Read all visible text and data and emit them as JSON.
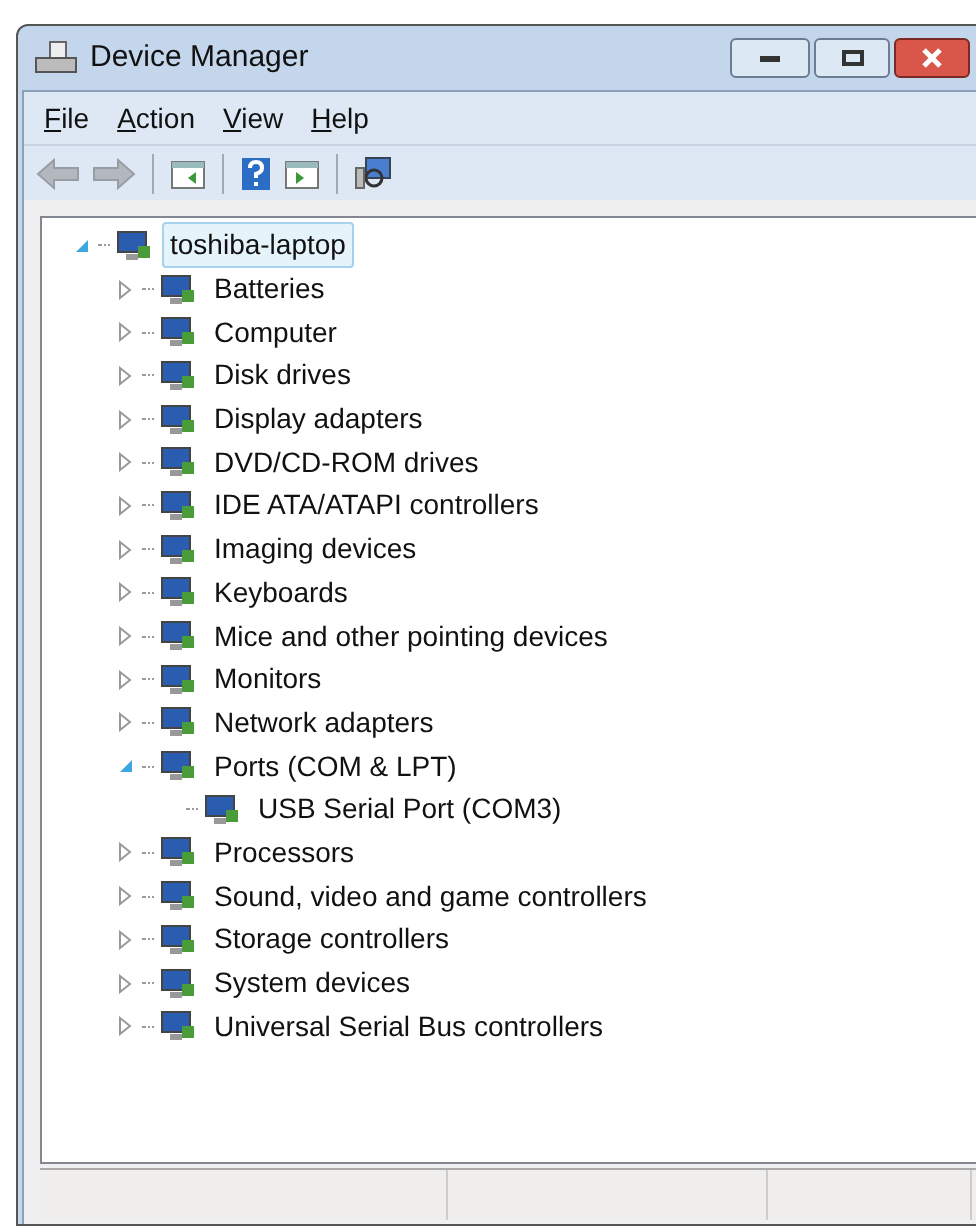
{
  "window": {
    "title": "Device Manager"
  },
  "menu": [
    {
      "label": "File"
    },
    {
      "label": "Action"
    },
    {
      "label": "View"
    },
    {
      "label": "Help"
    }
  ],
  "toolbar": [
    {
      "kind": "back",
      "disabled": true
    },
    {
      "kind": "forward",
      "disabled": true
    },
    {
      "kind": "separator"
    },
    {
      "kind": "console-tree"
    },
    {
      "kind": "separator"
    },
    {
      "kind": "help"
    },
    {
      "kind": "action-pane"
    },
    {
      "kind": "separator"
    },
    {
      "kind": "scan"
    }
  ],
  "tree": {
    "label": "toshiba-laptop",
    "selected": true,
    "expanded": true,
    "children": [
      {
        "label": "Batteries",
        "expanded": false
      },
      {
        "label": "Computer",
        "expanded": false
      },
      {
        "label": "Disk drives",
        "expanded": false
      },
      {
        "label": "Display adapters",
        "expanded": false
      },
      {
        "label": "DVD/CD-ROM drives",
        "expanded": false
      },
      {
        "label": "IDE ATA/ATAPI controllers",
        "expanded": false
      },
      {
        "label": "Imaging devices",
        "expanded": false
      },
      {
        "label": "Keyboards",
        "expanded": false
      },
      {
        "label": "Mice and other pointing devices",
        "expanded": false
      },
      {
        "label": "Monitors",
        "expanded": false
      },
      {
        "label": "Network adapters",
        "expanded": false
      },
      {
        "label": "Ports (COM & LPT)",
        "expanded": true,
        "children": [
          {
            "label": "USB Serial Port (COM3)"
          }
        ]
      },
      {
        "label": "Processors",
        "expanded": false
      },
      {
        "label": "Sound, video and game controllers",
        "expanded": false
      },
      {
        "label": "Storage controllers",
        "expanded": false
      },
      {
        "label": "System devices",
        "expanded": false
      },
      {
        "label": "Universal Serial Bus controllers",
        "expanded": false
      }
    ]
  }
}
